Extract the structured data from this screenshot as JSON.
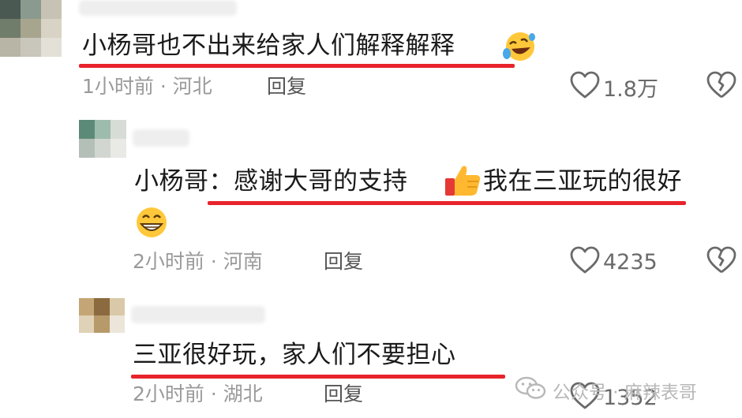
{
  "comments": [
    {
      "text": "小杨哥也不出来给家人们解释解释",
      "time": "1小时前",
      "location": "河北",
      "reply_label": "回复",
      "likes": "1.8万"
    },
    {
      "text_line1": "小杨哥：感谢大哥的支持",
      "text_line1b": "我在三亚玩的很好",
      "time": "2小时前",
      "location": "河南",
      "reply_label": "回复",
      "likes": "4235"
    },
    {
      "text": "三亚很好玩，家人们不要担心",
      "time": "2小时前",
      "location": "湖北",
      "reply_label": "回复",
      "likes": "1352"
    }
  ],
  "separator": "·",
  "watermark": "公众号 · 麻辣表哥",
  "colors": {
    "underline": "#e8232b",
    "meta": "#9a9a9a",
    "text": "#1a1a1a"
  }
}
